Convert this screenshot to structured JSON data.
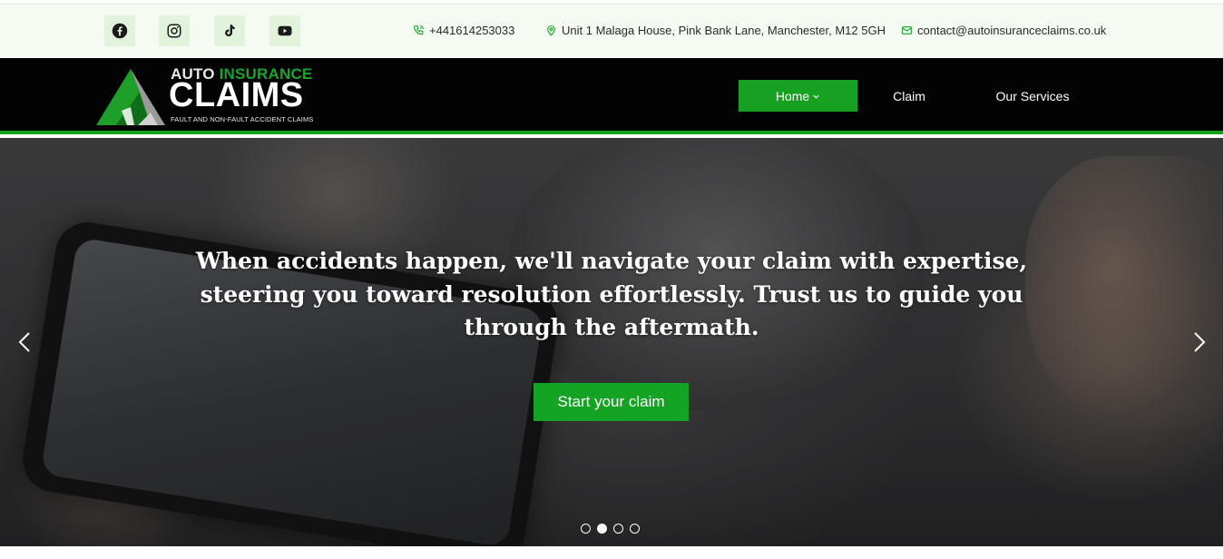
{
  "topbar": {
    "socials": [
      {
        "name": "facebook-icon"
      },
      {
        "name": "instagram-icon"
      },
      {
        "name": "tiktok-icon"
      },
      {
        "name": "youtube-icon"
      }
    ],
    "phone": "+441614253033",
    "address": "Unit 1 Malaga House, Pink Bank Lane, Manchester, M12 5GH",
    "email": "contact@autoinsuranceclaims.co.uk"
  },
  "brand": {
    "top_auto": "AUTO",
    "top_insurance": "INSURANCE",
    "main": "CLAIMS",
    "sub": "FAULT AND NON-FAULT ACCIDENT CLAIMS"
  },
  "nav": {
    "home": "Home",
    "claim": "Claim",
    "services": "Our Services"
  },
  "hero": {
    "headline": "When accidents happen, we'll navigate your claim with expertise, steering you toward resolution effortlessly. Trust us to guide you through the aftermath.",
    "cta": "Start your claim",
    "slides_total": 4,
    "active_slide": 2
  },
  "colors": {
    "accent": "#15a324",
    "navbar_bg": "#030304",
    "topbar_bg": "#f5fbf3"
  }
}
